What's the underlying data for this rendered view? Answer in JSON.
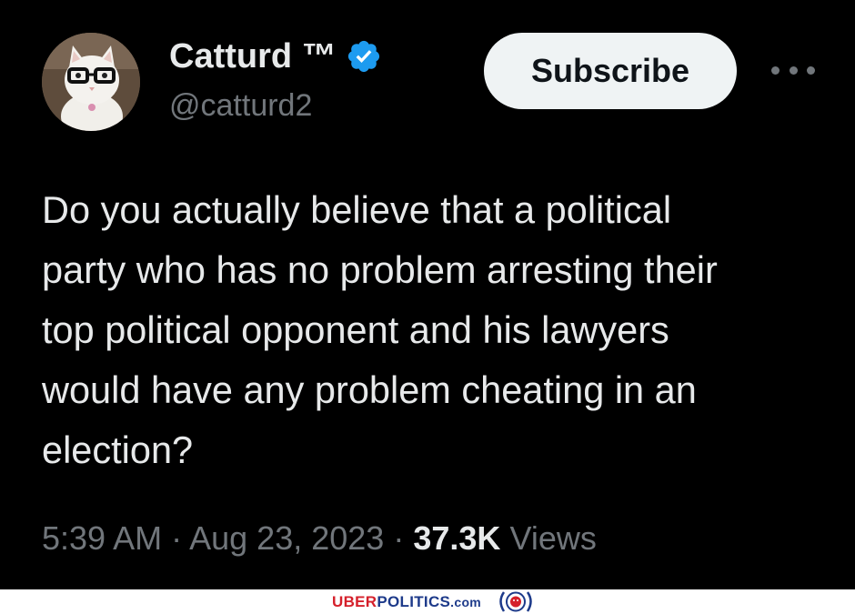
{
  "tweet": {
    "author": {
      "display_name": "Catturd ™",
      "handle": "@catturd2",
      "verified_icon": "verified-badge-icon"
    },
    "subscribe_label": "Subscribe",
    "more_icon": "more-options-icon",
    "text": "Do you actually believe that a political\nparty who has no problem arresting their\ntop political opponent and his lawyers\nwould have any problem cheating in an\nelection?",
    "time": "5:39 AM",
    "separator": "·",
    "date": "Aug 23, 2023",
    "views_count": "37.3K",
    "views_label": "Views"
  },
  "watermark": {
    "brand_uber": "UBER",
    "brand_politics": "POLITICS",
    "brand_suffix": ".com"
  },
  "colors": {
    "background": "#000000",
    "text_primary": "#e7e9ea",
    "text_secondary": "#71767b",
    "verified_blue": "#1d9bf0",
    "subscribe_bg": "#eff3f4",
    "brand_red": "#d5202b",
    "brand_blue": "#1d3a8a"
  }
}
